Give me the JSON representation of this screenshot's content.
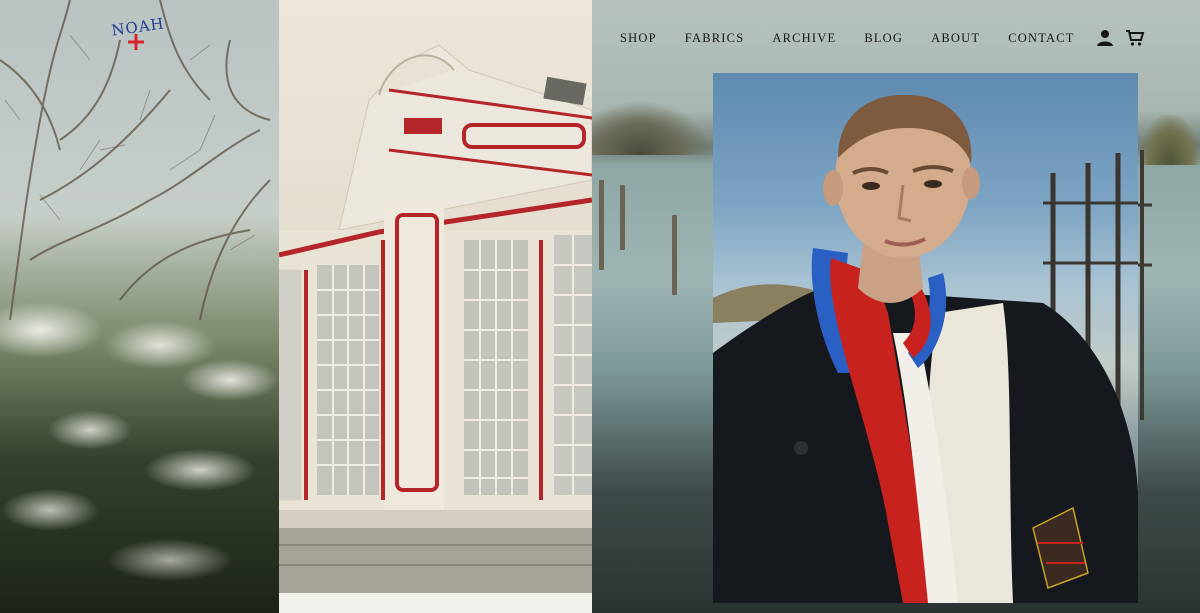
{
  "brand": {
    "logo_text": "NOAH",
    "accent_blue": "#233a8e",
    "accent_red": "#d6262b"
  },
  "nav": {
    "items": [
      {
        "label": "SHOP"
      },
      {
        "label": "FABRICS"
      },
      {
        "label": "ARCHIVE"
      },
      {
        "label": "BLOG"
      },
      {
        "label": "ABOUT"
      },
      {
        "label": "CONTACT"
      }
    ],
    "icons": [
      "account-icon",
      "cart-icon"
    ]
  },
  "hero": {
    "images": [
      "winter-trees-photo",
      "conservatory-photo",
      "portrait-photo"
    ]
  }
}
